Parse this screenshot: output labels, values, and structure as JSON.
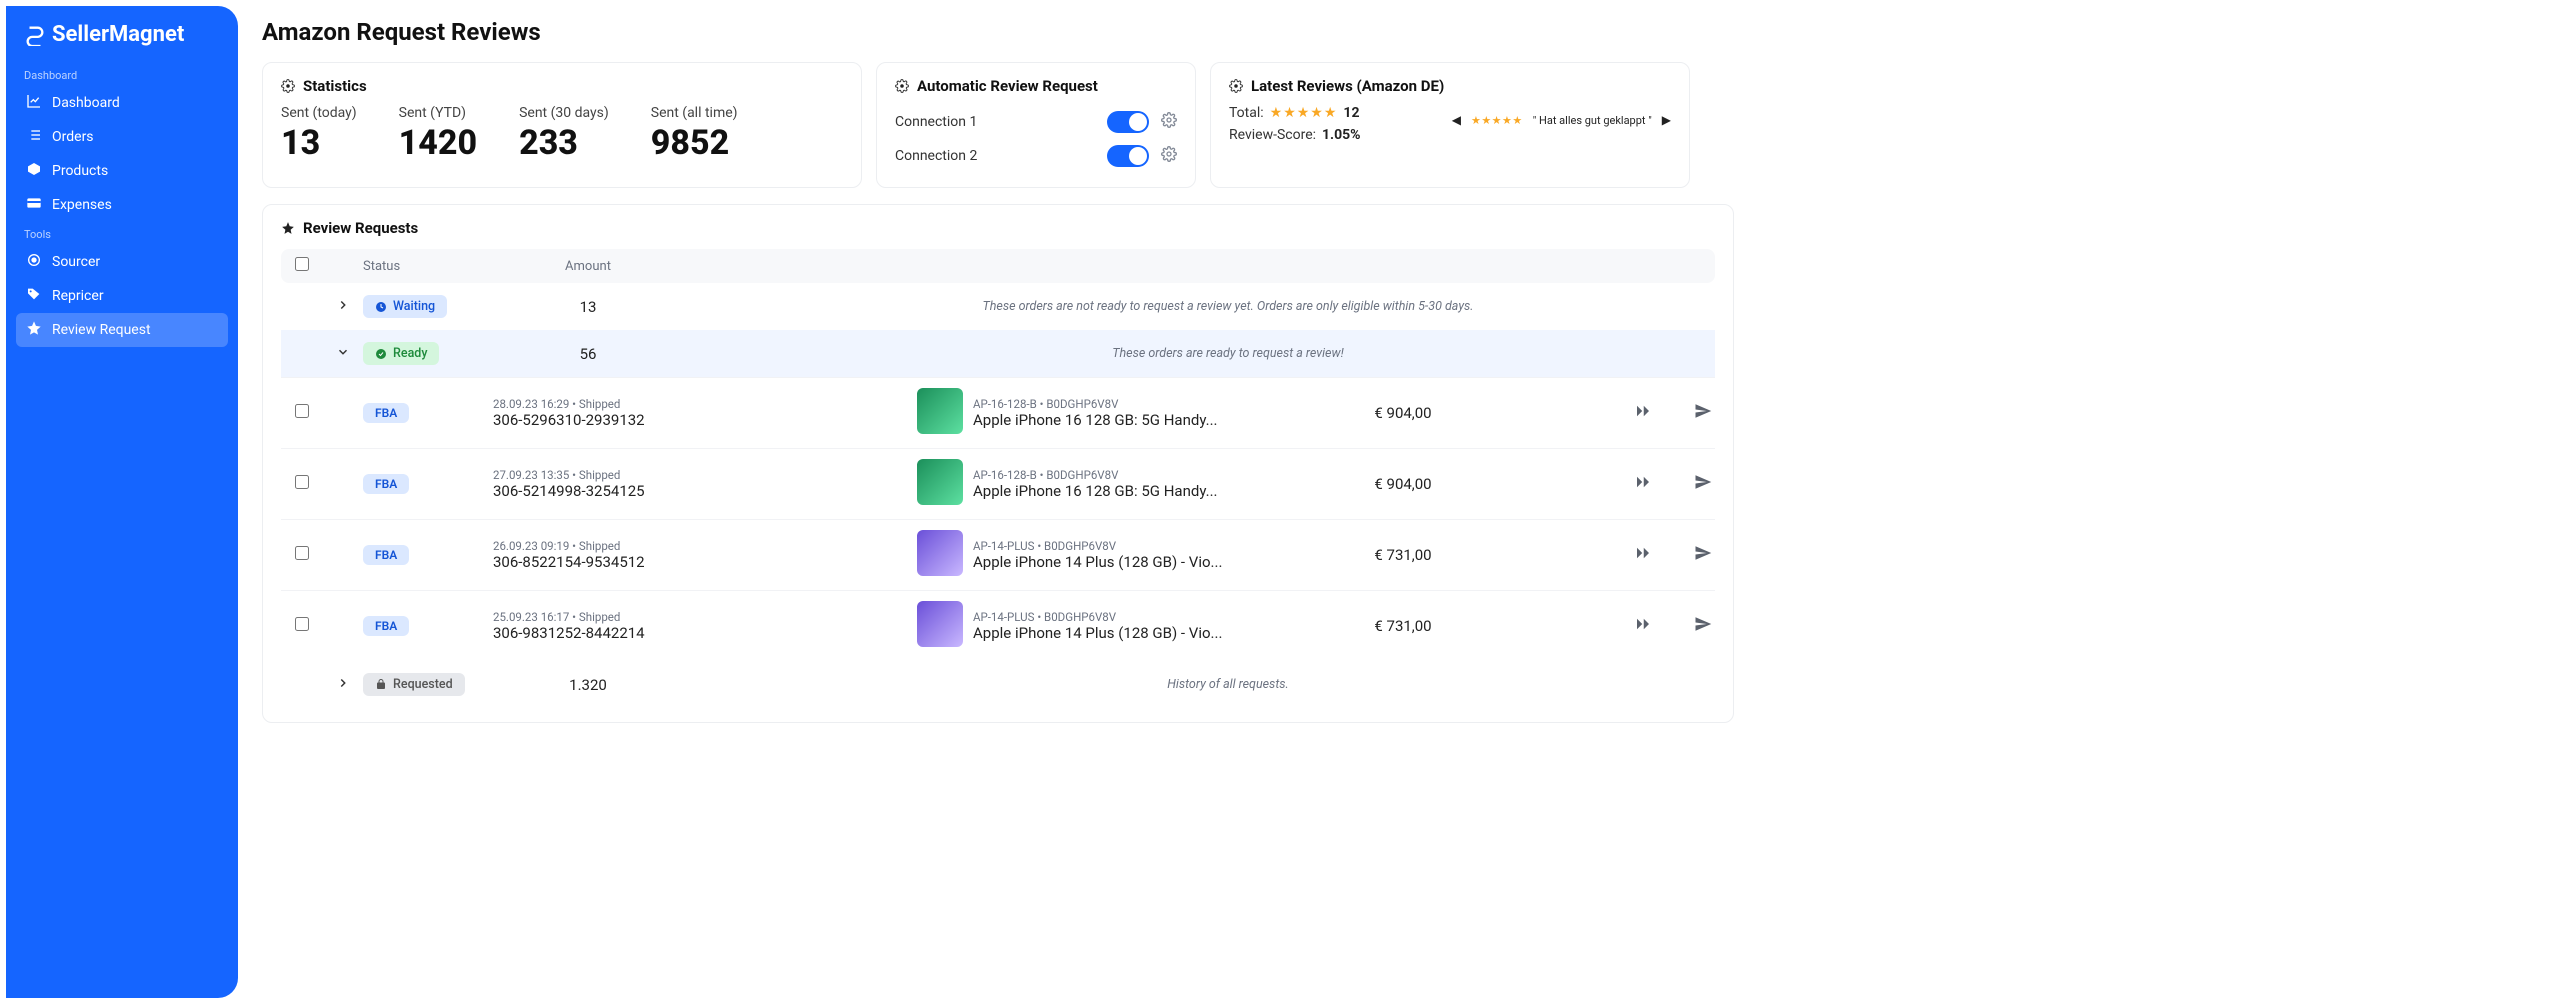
{
  "brand": "SellerMagnet",
  "nav": {
    "sections": [
      {
        "heading": "Dashboard",
        "items": [
          {
            "label": "Dashboard",
            "icon": "chart"
          },
          {
            "label": "Orders",
            "icon": "list"
          },
          {
            "label": "Products",
            "icon": "box"
          },
          {
            "label": "Expenses",
            "icon": "card"
          }
        ]
      },
      {
        "heading": "Tools",
        "items": [
          {
            "label": "Sourcer",
            "icon": "target"
          },
          {
            "label": "Repricer",
            "icon": "tag"
          },
          {
            "label": "Review Request",
            "icon": "star",
            "active": true
          }
        ]
      }
    ]
  },
  "page": {
    "title": "Amazon Request Reviews"
  },
  "stats": {
    "title": "Statistics",
    "items": [
      {
        "label": "Sent (today)",
        "value": "13"
      },
      {
        "label": "Sent (YTD)",
        "value": "1420"
      },
      {
        "label": "Sent (30 days)",
        "value": "233"
      },
      {
        "label": "Sent (all time)",
        "value": "9852"
      }
    ]
  },
  "auto": {
    "title": "Automatic Review Request",
    "connections": [
      {
        "label": "Connection 1",
        "on": true
      },
      {
        "label": "Connection 2",
        "on": true
      }
    ]
  },
  "reviews": {
    "title": "Latest Reviews (Amazon DE)",
    "total_label": "Total:",
    "total_count": "12",
    "score_label": "Review-Score:",
    "score_value": "1.05%",
    "quote": "\" Hat alles gut geklappt \""
  },
  "requests": {
    "title": "Review Requests",
    "headers": {
      "status": "Status",
      "amount": "Amount"
    },
    "groups": [
      {
        "key": "waiting",
        "label": "Waiting",
        "amount": "13",
        "note": "These orders are not ready to request a review yet. Orders are only eligible within 5-30 days.",
        "expanded": false
      },
      {
        "key": "ready",
        "label": "Ready",
        "amount": "56",
        "note": "These orders are ready to request a review!",
        "expanded": true
      },
      {
        "key": "requested",
        "label": "Requested",
        "amount": "1.320",
        "note": "History of all requests.",
        "expanded": false
      }
    ],
    "orders": [
      {
        "ship": "28.09.23 16:29 • Shipped",
        "order_id": "306-5296310-2939132",
        "sku": "AP-16-128-B  •  B0DGHP6V8V",
        "name": "Apple iPhone 16 128 GB: 5G Handy...",
        "price": "€ 904,00",
        "thumb": "green",
        "badge": "FBA"
      },
      {
        "ship": "27.09.23 13:35 • Shipped",
        "order_id": "306-5214998-3254125",
        "sku": "AP-16-128-B  •  B0DGHP6V8V",
        "name": "Apple iPhone 16 128 GB: 5G Handy...",
        "price": "€ 904,00",
        "thumb": "green",
        "badge": "FBA"
      },
      {
        "ship": "26.09.23 09:19 • Shipped",
        "order_id": "306-8522154-9534512",
        "sku": "AP-14-PLUS   •  B0DGHP6V8V",
        "name": "Apple iPhone 14 Plus (128 GB) - Vio...",
        "price": "€ 731,00",
        "thumb": "violet",
        "badge": "FBA"
      },
      {
        "ship": "25.09.23 16:17 • Shipped",
        "order_id": "306-9831252-8442214",
        "sku": "AP-14-PLUS   •  B0DGHP6V8V",
        "name": "Apple iPhone 14 Plus (128 GB) - Vio...",
        "price": "€ 731,00",
        "thumb": "violet",
        "badge": "FBA"
      }
    ]
  }
}
